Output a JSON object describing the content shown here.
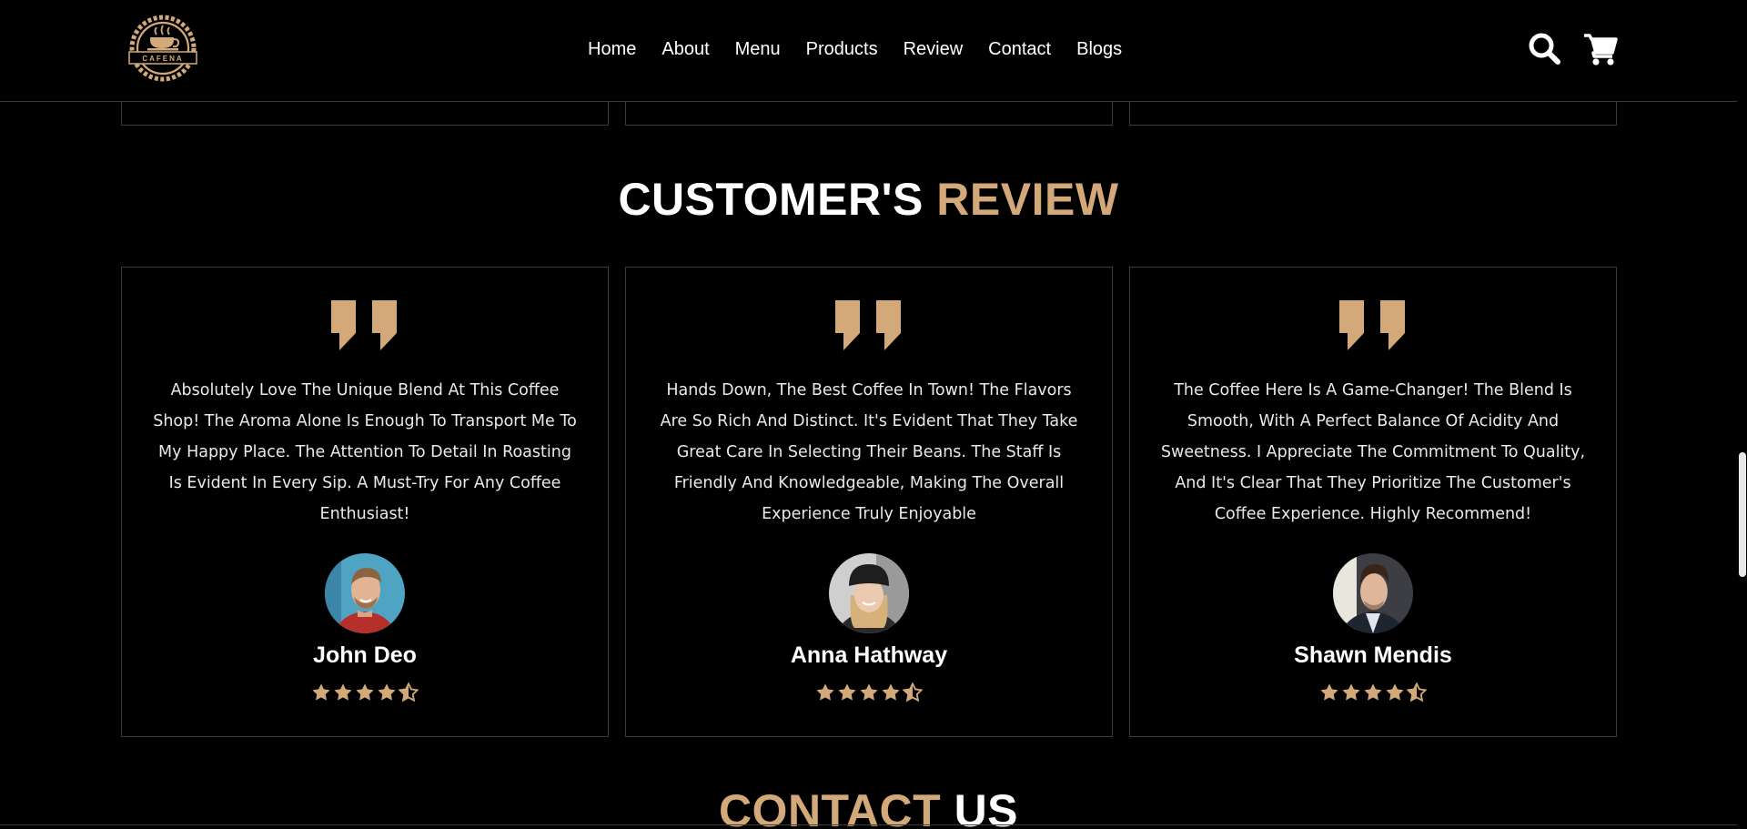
{
  "header": {
    "logo_text": "CAFENA",
    "nav": [
      {
        "label": "Home"
      },
      {
        "label": "About"
      },
      {
        "label": "Menu"
      },
      {
        "label": "Products"
      },
      {
        "label": "Review"
      },
      {
        "label": "Contact"
      },
      {
        "label": "Blogs"
      }
    ],
    "icons": [
      "search-icon",
      "cart-icon"
    ]
  },
  "review_section": {
    "title_main": "CUSTOMER'S",
    "title_accent": "REVIEW",
    "reviews": [
      {
        "text": "Absolutely Love The Unique Blend At This Coffee Shop! The Aroma Alone Is Enough To Transport Me To My Happy Place. The Attention To Detail In Roasting Is Evident In Every Sip. A Must-Try For Any Coffee Enthusiast!",
        "name": "John Deo",
        "rating": 4.5
      },
      {
        "text": "Hands Down, The Best Coffee In Town! The Flavors Are So Rich And Distinct. It's Evident That They Take Great Care In Selecting Their Beans. The Staff Is Friendly And Knowledgeable, Making The Overall Experience Truly Enjoyable",
        "name": "Anna Hathway",
        "rating": 4.5
      },
      {
        "text": "The Coffee Here Is A Game-Changer! The Blend Is Smooth, With A Perfect Balance Of Acidity And Sweetness. I Appreciate The Commitment To Quality, And It's Clear That They Prioritize The Customer's Coffee Experience. Highly Recommend!",
        "name": "Shawn Mendis",
        "rating": 4.5
      }
    ]
  },
  "contact_section": {
    "title_accent": "CONTACT",
    "title_main": "US"
  },
  "colors": {
    "accent": "#d3a97a",
    "background": "#000000",
    "border": "#3a3a3a",
    "text": "#ffffff"
  }
}
